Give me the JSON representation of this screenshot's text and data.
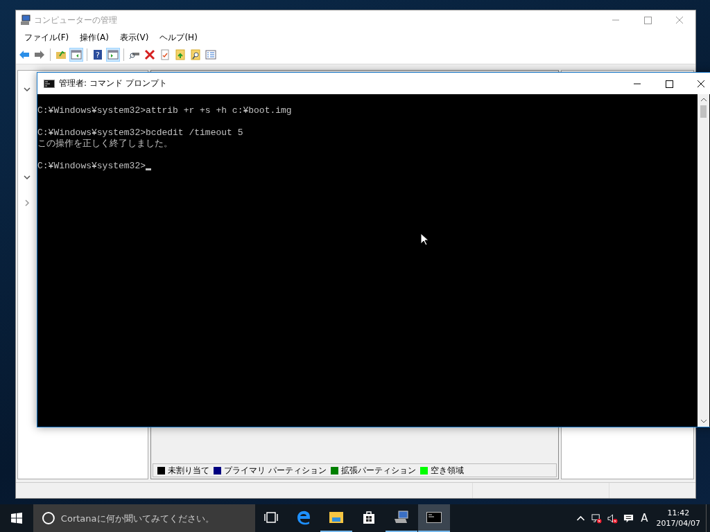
{
  "mmc_window": {
    "title": "コンピューターの管理",
    "menus": [
      "ファイル(F)",
      "操作(A)",
      "表示(V)",
      "ヘルプ(H)"
    ],
    "toolbar_groups": [
      [
        {
          "kind": "back"
        },
        {
          "kind": "forward"
        }
      ],
      [
        {
          "kind": "up"
        },
        {
          "kind": "tree",
          "pressed": true
        }
      ],
      [
        {
          "kind": "help",
          "glyph": "?"
        },
        {
          "kind": "actionpane",
          "pressed": true
        }
      ],
      [
        {
          "kind": "connect"
        },
        {
          "kind": "delete"
        },
        {
          "kind": "properties"
        },
        {
          "kind": "export"
        },
        {
          "kind": "find"
        },
        {
          "kind": "list"
        }
      ]
    ],
    "tree": [
      {
        "expanded": true
      },
      {
        "expanded": true
      },
      {
        "expanded": false
      }
    ],
    "legend": [
      {
        "label": "未割り当て",
        "color": "#000000"
      },
      {
        "label": "プライマリ パーティション",
        "color": "#000080"
      },
      {
        "label": "拡張パーティション",
        "color": "#008000"
      },
      {
        "label": "空き領域",
        "color": "#00ff00"
      }
    ]
  },
  "console_window": {
    "title": "管理者: コマンド プロンプト",
    "blocks": [
      [
        "C:¥Windows¥system32>attrib +r +s +h c:¥boot.img"
      ],
      [
        "C:¥Windows¥system32>bcdedit /timeout 5",
        "この操作を正しく終了しました。"
      ],
      [
        "C:¥Windows¥system32>"
      ]
    ],
    "cursor": true
  },
  "taskbar": {
    "search": {
      "placeholder": "Cortanaに何か聞いてみてください。"
    },
    "apps": [
      {
        "kind": "taskview",
        "running": false,
        "selected": false
      },
      {
        "kind": "edge",
        "running": false,
        "selected": false
      },
      {
        "kind": "explorer",
        "running": true,
        "selected": false
      },
      {
        "kind": "store",
        "running": false,
        "selected": false
      },
      {
        "kind": "compmgmt",
        "running": true,
        "selected": false
      },
      {
        "kind": "cmd",
        "running": true,
        "selected": true
      }
    ],
    "ime": "A",
    "time": "11:42",
    "date": "2017/04/07"
  }
}
